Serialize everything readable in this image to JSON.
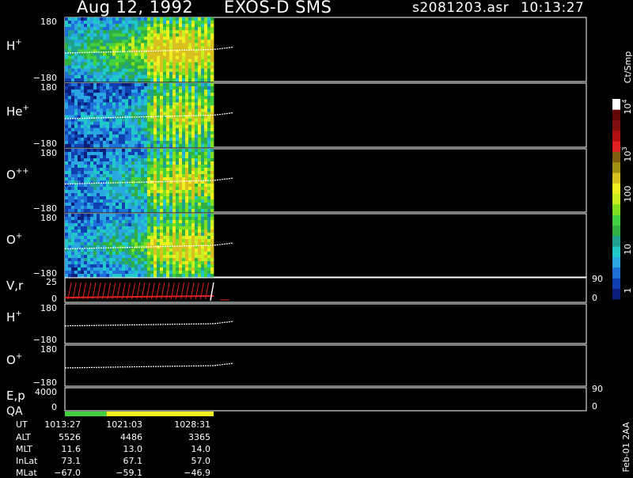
{
  "header": {
    "date": "Aug 12, 1992",
    "instrument": "EXOS-D SMS",
    "file": "s2081203.asr",
    "time": "10:13:27"
  },
  "colorbar": {
    "unit": "Ct/Smp",
    "ticks": [
      "1",
      "10",
      "100",
      "10",
      "10"
    ],
    "tick_exponents": [
      "",
      "",
      "",
      "3",
      "4"
    ],
    "colors": [
      "#0a1f7a",
      "#1040b0",
      "#1e70d8",
      "#2aa6e0",
      "#20c8c8",
      "#20a090",
      "#30b040",
      "#40d040",
      "#80e020",
      "#c8f020",
      "#f0f020",
      "#d8c020",
      "#a09010",
      "#806010",
      "#e02020",
      "#b01010",
      "#801010",
      "#600808",
      "#ffffff"
    ]
  },
  "footer_note": "Feb-01 2AA",
  "chart_data": [
    {
      "type": "heatmap",
      "panel_label": "H",
      "panel_label_sup": "+",
      "ylim": [
        -180,
        180
      ],
      "ytick_top": "180",
      "ytick_bottom": "−180",
      "intensity_profile": [
        0.5,
        0.6,
        0.7,
        0.8,
        0.95,
        1.0,
        0.9
      ],
      "trace": {
        "x": [
          0,
          1
        ],
        "y": [
          -20,
          0
        ]
      }
    },
    {
      "type": "heatmap",
      "panel_label": "He",
      "panel_label_sup": "+",
      "ylim": [
        -180,
        180
      ],
      "ytick_top": "180",
      "ytick_bottom": "−180",
      "intensity_profile": [
        0.25,
        0.3,
        0.35,
        0.45,
        0.7,
        0.8,
        0.7
      ],
      "trace": {
        "x": [
          0,
          1
        ],
        "y": [
          -20,
          0
        ]
      }
    },
    {
      "type": "heatmap",
      "panel_label": "O",
      "panel_label_sup": "++",
      "ylim": [
        -180,
        180
      ],
      "ytick_top": "180",
      "ytick_bottom": "−180",
      "intensity_profile": [
        0.3,
        0.35,
        0.45,
        0.55,
        0.75,
        0.85,
        0.75
      ],
      "trace": {
        "x": [
          0,
          1
        ],
        "y": [
          -20,
          0
        ]
      }
    },
    {
      "type": "heatmap",
      "panel_label": "O",
      "panel_label_sup": "+",
      "ylim": [
        -180,
        180
      ],
      "ytick_top": "180",
      "ytick_bottom": "−180",
      "intensity_profile": [
        0.35,
        0.4,
        0.5,
        0.6,
        0.8,
        0.9,
        0.8
      ],
      "trace": {
        "x": [
          0,
          1
        ],
        "y": [
          -20,
          0
        ]
      }
    },
    {
      "type": "line",
      "panel_label": "V,r",
      "ylim": [
        0,
        25
      ],
      "ytick_top": "25",
      "ytick_bottom": "0",
      "right_ticks": [
        "90",
        "0"
      ],
      "series": [
        {
          "color": "#e02020"
        },
        {
          "color": "#ffffff"
        }
      ]
    },
    {
      "type": "line",
      "panel_label": "H",
      "panel_label_sup": "+",
      "ylim": [
        -180,
        180
      ],
      "ytick_top": "180",
      "ytick_bottom": "−180",
      "trace": {
        "x": [
          0,
          1
        ],
        "y": [
          -20,
          0
        ]
      }
    },
    {
      "type": "line",
      "panel_label": "O",
      "panel_label_sup": "+",
      "ylim": [
        -180,
        180
      ],
      "ytick_top": "180",
      "ytick_bottom": "−180",
      "trace": {
        "x": [
          0,
          1
        ],
        "y": [
          -20,
          0
        ]
      }
    },
    {
      "type": "line",
      "panel_label": "E,p",
      "ylim": [
        0,
        4000
      ],
      "ytick_top": "4000",
      "ytick_bottom": "0",
      "right_ticks": [
        "90",
        "0"
      ]
    }
  ],
  "qa": {
    "label": "QA",
    "segments": [
      {
        "x0": 0.0,
        "x1": 0.28,
        "color": "#40d040"
      },
      {
        "x0": 0.28,
        "x1": 1.0,
        "color": "#f0f020"
      }
    ]
  },
  "ephemeris": {
    "labels": [
      "UT",
      "ALT",
      "MLT",
      "InLat",
      "MLat"
    ],
    "columns": [
      [
        "1013:27",
        "5526",
        "11.6",
        "73.1",
        "−67.0"
      ],
      [
        "1021:03",
        "4486",
        "13.0",
        "67.1",
        "−59.1"
      ],
      [
        "1028:31",
        "3365",
        "14.0",
        "57.0",
        "−46.9"
      ]
    ]
  }
}
